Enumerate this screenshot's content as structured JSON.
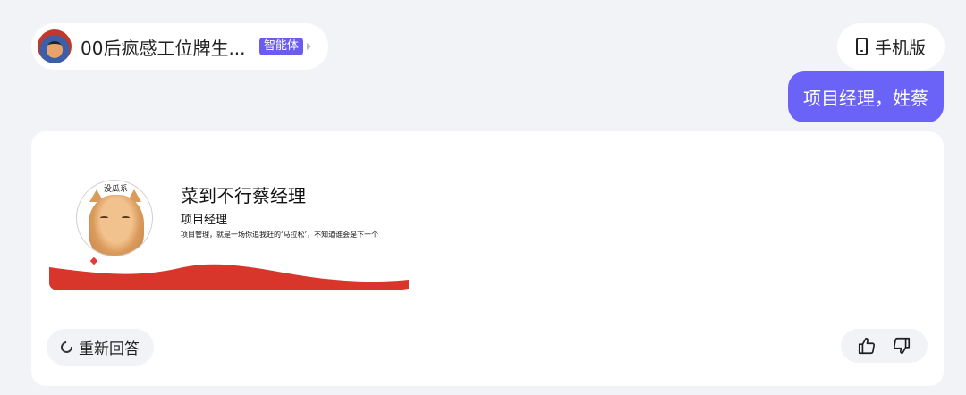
{
  "header": {
    "agent_name": "00后疯感工位牌生...",
    "agent_tag": "智能体",
    "mobile_label": "手机版"
  },
  "chat": {
    "user_message": "项目经理，姓蔡"
  },
  "response": {
    "nameplate": {
      "avatar_label": "没瓜系",
      "title": "菜到不行蔡经理",
      "role": "项目经理",
      "motto": "项目管理，就是一场你追我赶的‘马拉松’，不知道谁会是下一个",
      "wave_color": "#d9362b"
    },
    "regenerate_label": "重新回答"
  },
  "icons": {
    "agent_avatar": "agent-avatar",
    "mobile": "phone-icon",
    "regenerate": "refresh-icon",
    "like": "thumbs-up-icon",
    "dislike": "thumbs-down-icon"
  },
  "colors": {
    "accent": "#6b63f7",
    "tag": "#6b5bf0",
    "background": "#f2f3f7"
  }
}
